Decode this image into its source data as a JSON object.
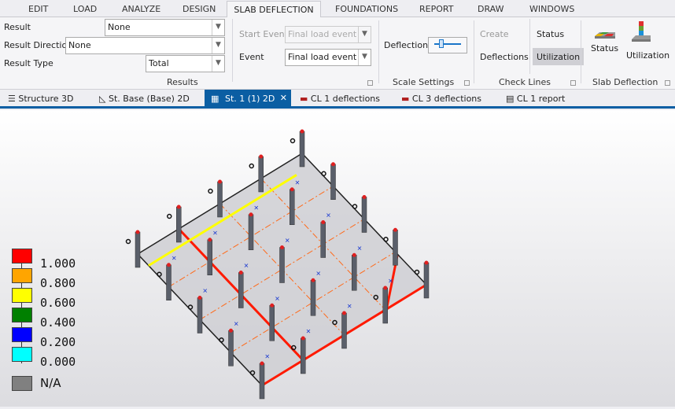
{
  "menu": {
    "tabs": [
      "EDIT",
      "LOAD",
      "ANALYZE",
      "DESIGN",
      "SLAB DEFLECTION",
      "FOUNDATIONS",
      "REPORT",
      "DRAW",
      "WINDOWS"
    ],
    "active": "SLAB DEFLECTION"
  },
  "results": {
    "result_label": "Result",
    "result_value": "None",
    "direction_label": "Result Direction",
    "direction_value": "None",
    "type_label": "Result Type",
    "type_value": "Total",
    "start_event_label": "Start Event",
    "start_event_value": "Final load event",
    "event_label": "Event",
    "event_value": "Final load event",
    "group": "Results"
  },
  "scale": {
    "deflections_label": "Deflections",
    "group": "Scale Settings"
  },
  "checklines": {
    "create": "Create",
    "deflections": "Deflections",
    "status": "Status",
    "utilization": "Utilization",
    "group": "Check Lines"
  },
  "slabdef": {
    "status": "Status",
    "utilization": "Utilization",
    "group": "Slab Deflection"
  },
  "doctabs": [
    "Structure 3D",
    "St. Base (Base) 2D",
    "St. 1 (1) 2D",
    "CL 1 deflections",
    "CL 3 deflections",
    "CL 1 report"
  ],
  "legend": {
    "items": [
      {
        "color": "#ff0000",
        "label": "1.000"
      },
      {
        "color": "#ffa500",
        "label": "0.800"
      },
      {
        "color": "#ffff00",
        "label": "0.600"
      },
      {
        "color": "#008000",
        "label": "0.400"
      },
      {
        "color": "#0000ff",
        "label": "0.200"
      },
      {
        "color": "#00ffff",
        "label": "0.000"
      }
    ],
    "na_color": "#808080",
    "na_label": "N/A"
  }
}
